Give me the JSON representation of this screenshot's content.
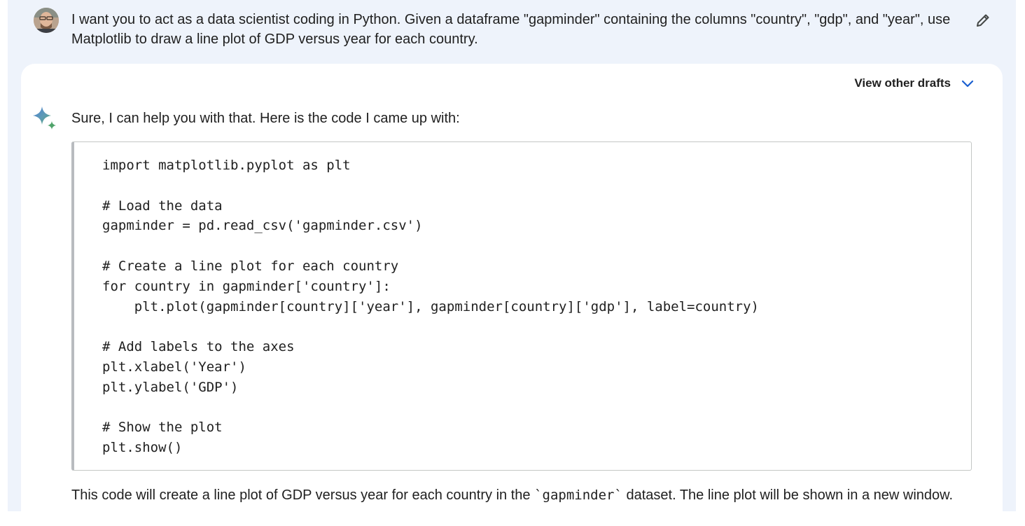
{
  "user_turn": {
    "prompt": "I want you to act as a data scientist coding in Python. Given a dataframe \"gapminder\" containing the columns \"country\", \"gdp\", and \"year\",  use Matplotlib to draw a line plot of GDP versus year for each country.",
    "avatar_icon": "user-avatar",
    "edit_icon": "pencil-icon"
  },
  "response": {
    "drafts_label": "View other drafts",
    "drafts_icon": "chevron-down-icon",
    "model_icon": "sparkle-icon",
    "intro": "Sure, I can help you with that. Here is the code I came up with:",
    "code_lines": [
      "import matplotlib.pyplot as plt",
      "",
      "# Load the data",
      "gapminder = pd.read_csv('gapminder.csv')",
      "",
      "# Create a line plot for each country",
      "for country in gapminder['country']:",
      "    plt.plot(gapminder[country]['year'], gapminder[country]['gdp'], label=country)",
      "",
      "# Add labels to the axes",
      "plt.xlabel('Year')",
      "plt.ylabel('GDP')",
      "",
      "# Show the plot",
      "plt.show()"
    ],
    "outro_before": "This code will create a line plot of GDP versus year for each country in the ",
    "outro_code": "`gapminder`",
    "outro_after": " dataset. The line plot will be shown in a new window."
  },
  "colors": {
    "page_background": "#eef3fb",
    "card_background": "#ffffff",
    "chevron": "#1a5fd0",
    "code_border": "#c4c7c5"
  }
}
